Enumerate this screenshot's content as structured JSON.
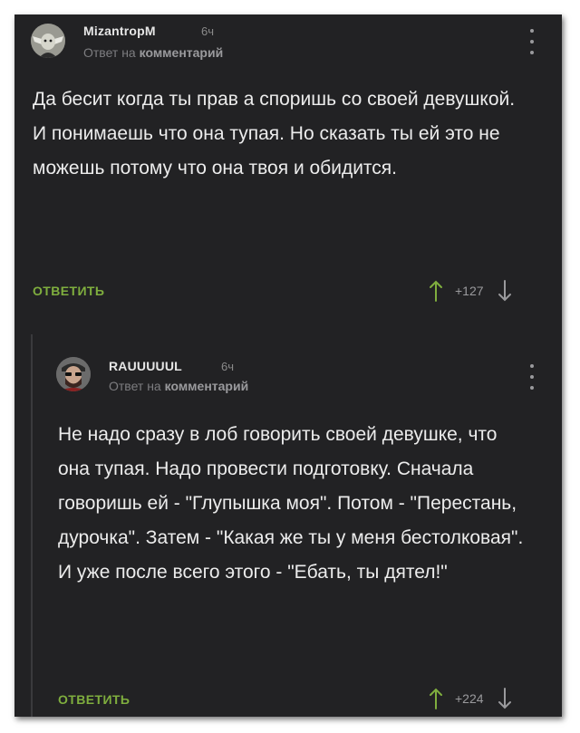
{
  "comments": [
    {
      "author": "MizantropM",
      "time": "6ч",
      "reply_prefix": "Ответ на",
      "reply_target": "комментарий",
      "paragraphs": [
        "Да бесит когда ты прав а споришь со своей девушкой.",
        "И понимаешь что она тупая. Но сказать ты ей это не можешь потому что она твоя и обидится."
      ],
      "reply_label": "ОТВЕТИТЬ",
      "rating": "+127",
      "avatar_icon": "yoda-avatar-icon"
    },
    {
      "author": "RAUUUUUL",
      "time": "6ч",
      "reply_prefix": "Ответ на",
      "reply_target": "комментарий",
      "paragraphs": [
        "Не надо сразу в лоб говорить своей девушке, что она тупая. Надо провести подготовку. Сначала говоришь ей - \"Глупышка моя\". Потом - \"Перестань, дурочка\". Затем - \"Какая же ты у меня бестолковая\". И уже после всего этого - \"Ебать, ты дятел!\""
      ],
      "reply_label": "ОТВЕТИТЬ",
      "rating": "+224",
      "avatar_icon": "bearded-man-avatar-icon"
    }
  ],
  "colors": {
    "background": "#222224",
    "reply_button": "#7fae3e",
    "text": "#ececec",
    "muted": "#8a8a8a"
  },
  "icons": [
    "upvote-arrow-icon",
    "downvote-arrow-icon",
    "more-menu-icon"
  ]
}
